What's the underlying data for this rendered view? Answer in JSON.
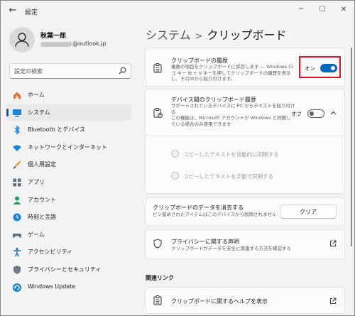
{
  "window": {
    "title": "設定",
    "back_glyph": "←",
    "min_glyph": "─",
    "max_glyph": "☐",
    "close_glyph": "✕"
  },
  "user": {
    "name": "秋葉一郎",
    "email_suffix": "@outlook.jp"
  },
  "search": {
    "placeholder": "設定の検索"
  },
  "nav": [
    {
      "label": "ホーム",
      "icon": "home-icon",
      "color": "#e07a3a"
    },
    {
      "label": "システム",
      "icon": "system-icon",
      "color": "#1a84d6",
      "active": true
    },
    {
      "label": "Bluetooth とデバイス",
      "icon": "bluetooth-icon",
      "color": "#1a84d6"
    },
    {
      "label": "ネットワークとインターネット",
      "icon": "network-icon",
      "color": "#1a84d6"
    },
    {
      "label": "個人用設定",
      "icon": "brush-icon",
      "color": "#e0952b"
    },
    {
      "label": "アプリ",
      "icon": "apps-icon",
      "color": "#5b6f8a"
    },
    {
      "label": "アカウント",
      "icon": "account-icon",
      "color": "#1fa35b"
    },
    {
      "label": "時刻と言語",
      "icon": "time-language-icon",
      "color": "#1a84d6"
    },
    {
      "label": "ゲーム",
      "icon": "gaming-icon",
      "color": "#5b6f8a"
    },
    {
      "label": "アクセシビリティ",
      "icon": "accessibility-icon",
      "color": "#1a6fc4"
    },
    {
      "label": "プライバシーとセキュリティ",
      "icon": "shield-icon",
      "color": "#6f7a88"
    },
    {
      "label": "Windows Update",
      "icon": "update-icon",
      "color": "#1a84d6"
    }
  ],
  "breadcrumb": {
    "parent": "システム",
    "separator": ">",
    "current": "クリップボード"
  },
  "history": {
    "title": "クリップボードの履歴",
    "desc": "複数の項目をクリップボードに保存します ― Windows ロゴ キー ⊞ + V キーを押してクリップボードの履歴を表示し、その中から貼り付けます。",
    "state": "オン"
  },
  "sync": {
    "title": "デバイス間のクリップボード履歴",
    "desc1": "サポートされているデバイスに PC からテキストを貼り付ける",
    "desc2": "この機能は、Microsoft アカウントが Windows と同期している場合のみ使用できます",
    "state": "オフ",
    "options": [
      "コピーしたテキストを自動的に同期する",
      "コピーしたテキストを手動で同期する"
    ]
  },
  "clear": {
    "title": "クリップボードのデータを消去する",
    "desc": "ピン留めされたアイテムはこのデバイスから削除されません",
    "button": "クリア"
  },
  "privacy": {
    "title": "プライバシーに関する声明",
    "desc": "クリップボードがデータを安全に保護する方法を確認する"
  },
  "related": {
    "heading": "関連リンク",
    "help": "クリップボードに関するヘルプを表示"
  },
  "colors": {
    "accent": "#0067c0",
    "highlight": "#e8101f"
  }
}
